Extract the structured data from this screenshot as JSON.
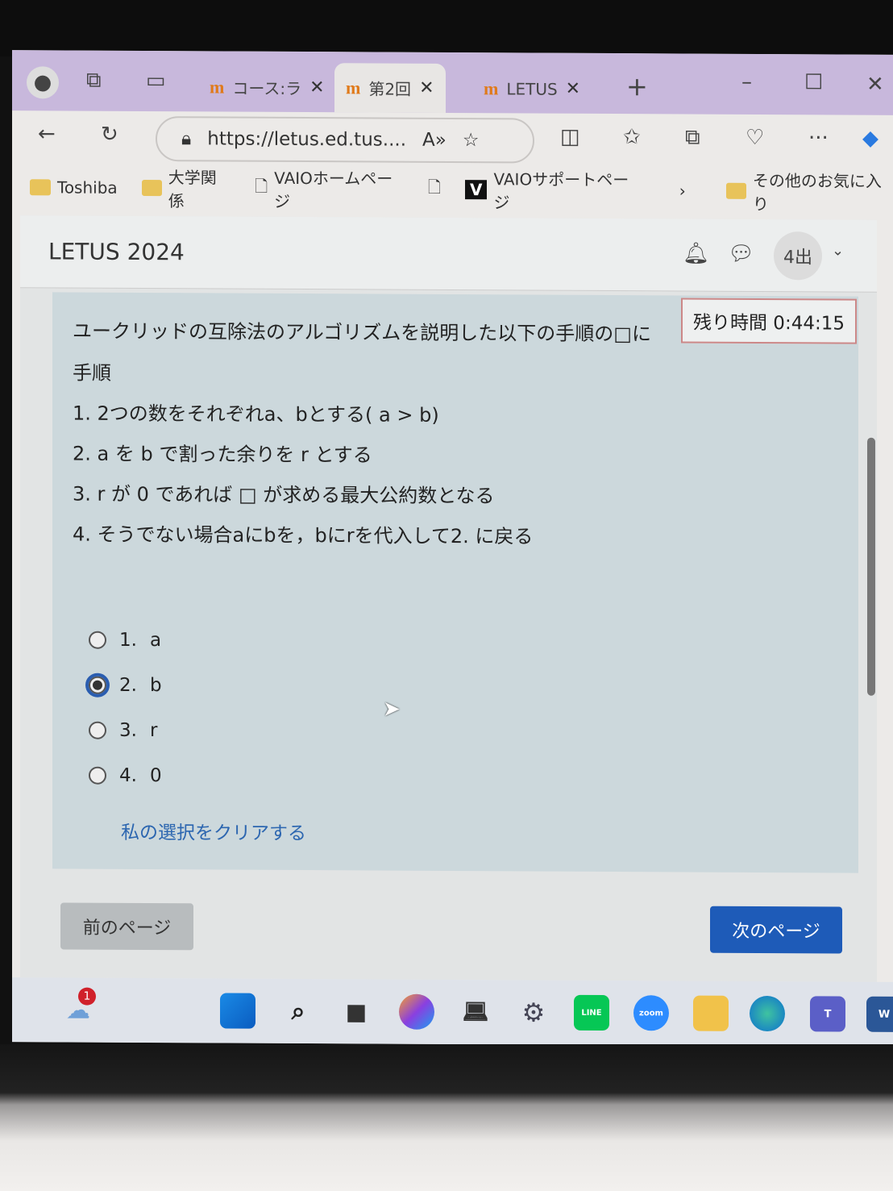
{
  "browser": {
    "tabs": [
      {
        "label": "コース:ラ"
      },
      {
        "label": "第2回"
      },
      {
        "label": "LETUS"
      }
    ],
    "url": "https://letus.ed.tus....",
    "bookmarks": [
      "Toshiba",
      "大学関係",
      "VAIOホームページ",
      "VAIOサポートページ",
      "その他のお気に入り"
    ]
  },
  "header": {
    "brand": "LETUS 2024",
    "user": "4出"
  },
  "quiz": {
    "timer": "残り時間 0:44:15",
    "question": "ユークリッドの互除法のアルゴリズムを説明した以下の手順の□に",
    "steps_title": "手順",
    "steps": [
      "1. 2つの数をそれぞれa、bとする( a > b)",
      "2. a を b で割った余りを r とする",
      "3. r が 0 であれば □ が求める最大公約数となる",
      "4. そうでない場合aにbを，bにrを代入して2. に戻る"
    ],
    "options": [
      {
        "num": "1.",
        "label": "a"
      },
      {
        "num": "2.",
        "label": "b",
        "selected": true
      },
      {
        "num": "3.",
        "label": "r"
      },
      {
        "num": "4.",
        "label": "0"
      }
    ],
    "clear": "私の選択をクリアする",
    "prev": "前のページ",
    "next": "次のページ"
  },
  "taskbar": {
    "badge": "1",
    "line": "LINE",
    "zoom": "zoom",
    "teams": "T",
    "word": "W"
  },
  "colors": {
    "accent": "#1e5bb8",
    "tabbar": "#c8b8dc"
  }
}
